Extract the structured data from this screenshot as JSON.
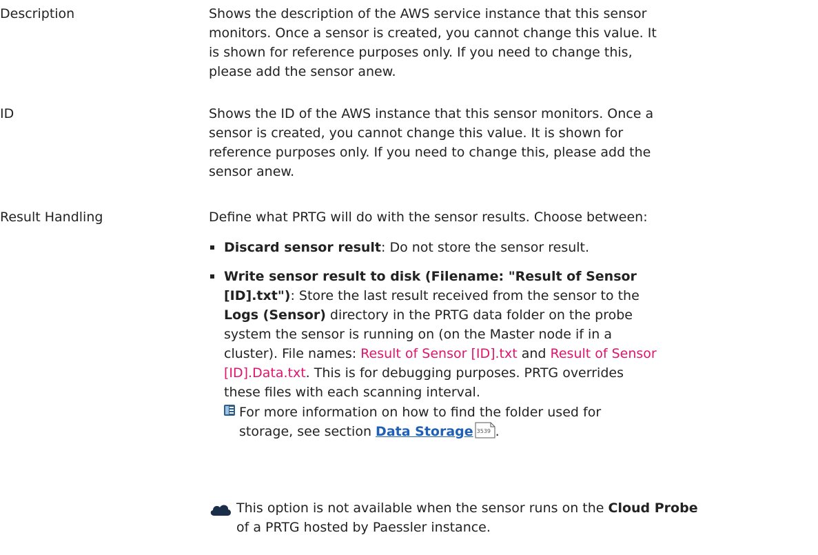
{
  "rows": [
    {
      "label": "Description",
      "text": "Shows the description of the AWS service instance that this sensor monitors. Once a sensor is created, you cannot change this value. It is shown for reference purposes only. If you need to change this, please add the sensor anew."
    },
    {
      "label": "ID",
      "text": "Shows the ID of the AWS instance that this sensor monitors.  Once a sensor is created, you cannot change this value. It is shown for reference purposes only. If you need to change this, please add the sensor anew."
    },
    {
      "label": "Result Handling",
      "intro": "Define what PRTG will do with the sensor results. Choose between:",
      "options": [
        {
          "bold": "Discard sensor result",
          "text": ": Do not store the sensor result."
        },
        {
          "bold": "Write sensor result to disk (Filename: \"Result of Sensor [ID].txt\")",
          "text_a": ": Store the last result received from the sensor to the ",
          "bold_b": "Logs (Sensor)",
          "text_b": " directory in the PRTG data folder on the probe system the sensor is running on (on the Master node if in a cluster). File names: ",
          "file_1": "Result of Sensor [ID].txt",
          "text_c": " and ",
          "file_2": "Result of Sensor [ID].Data.txt",
          "text_d": ". This is for debugging purposes. PRTG overrides these files with each scanning interval."
        }
      ],
      "note_text": "For more information on how to find the folder used for storage, see section ",
      "note_link": "Data Storage",
      "note_page": "3539",
      "cloud_text_a": "This option is not available when the sensor runs on the ",
      "cloud_bold": "Cloud Probe",
      "cloud_text_b": " of a PRTG hosted by Paessler instance."
    }
  ]
}
